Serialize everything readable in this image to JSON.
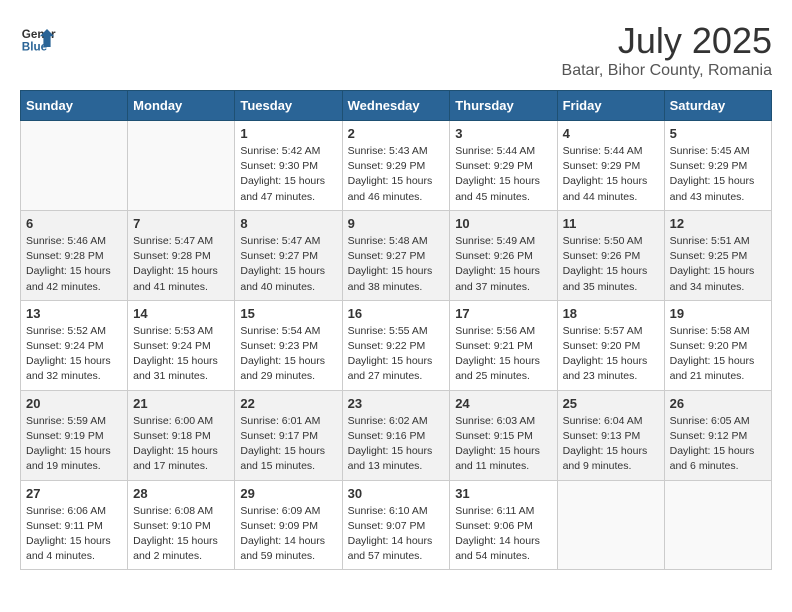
{
  "header": {
    "logo_line1": "General",
    "logo_line2": "Blue",
    "month_year": "July 2025",
    "location": "Batar, Bihor County, Romania"
  },
  "weekdays": [
    "Sunday",
    "Monday",
    "Tuesday",
    "Wednesday",
    "Thursday",
    "Friday",
    "Saturday"
  ],
  "weeks": [
    [
      {
        "day": "",
        "info": ""
      },
      {
        "day": "",
        "info": ""
      },
      {
        "day": "1",
        "sunrise": "5:42 AM",
        "sunset": "9:30 PM",
        "daylight": "15 hours and 47 minutes."
      },
      {
        "day": "2",
        "sunrise": "5:43 AM",
        "sunset": "9:29 PM",
        "daylight": "15 hours and 46 minutes."
      },
      {
        "day": "3",
        "sunrise": "5:44 AM",
        "sunset": "9:29 PM",
        "daylight": "15 hours and 45 minutes."
      },
      {
        "day": "4",
        "sunrise": "5:44 AM",
        "sunset": "9:29 PM",
        "daylight": "15 hours and 44 minutes."
      },
      {
        "day": "5",
        "sunrise": "5:45 AM",
        "sunset": "9:29 PM",
        "daylight": "15 hours and 43 minutes."
      }
    ],
    [
      {
        "day": "6",
        "sunrise": "5:46 AM",
        "sunset": "9:28 PM",
        "daylight": "15 hours and 42 minutes."
      },
      {
        "day": "7",
        "sunrise": "5:47 AM",
        "sunset": "9:28 PM",
        "daylight": "15 hours and 41 minutes."
      },
      {
        "day": "8",
        "sunrise": "5:47 AM",
        "sunset": "9:27 PM",
        "daylight": "15 hours and 40 minutes."
      },
      {
        "day": "9",
        "sunrise": "5:48 AM",
        "sunset": "9:27 PM",
        "daylight": "15 hours and 38 minutes."
      },
      {
        "day": "10",
        "sunrise": "5:49 AM",
        "sunset": "9:26 PM",
        "daylight": "15 hours and 37 minutes."
      },
      {
        "day": "11",
        "sunrise": "5:50 AM",
        "sunset": "9:26 PM",
        "daylight": "15 hours and 35 minutes."
      },
      {
        "day": "12",
        "sunrise": "5:51 AM",
        "sunset": "9:25 PM",
        "daylight": "15 hours and 34 minutes."
      }
    ],
    [
      {
        "day": "13",
        "sunrise": "5:52 AM",
        "sunset": "9:24 PM",
        "daylight": "15 hours and 32 minutes."
      },
      {
        "day": "14",
        "sunrise": "5:53 AM",
        "sunset": "9:24 PM",
        "daylight": "15 hours and 31 minutes."
      },
      {
        "day": "15",
        "sunrise": "5:54 AM",
        "sunset": "9:23 PM",
        "daylight": "15 hours and 29 minutes."
      },
      {
        "day": "16",
        "sunrise": "5:55 AM",
        "sunset": "9:22 PM",
        "daylight": "15 hours and 27 minutes."
      },
      {
        "day": "17",
        "sunrise": "5:56 AM",
        "sunset": "9:21 PM",
        "daylight": "15 hours and 25 minutes."
      },
      {
        "day": "18",
        "sunrise": "5:57 AM",
        "sunset": "9:20 PM",
        "daylight": "15 hours and 23 minutes."
      },
      {
        "day": "19",
        "sunrise": "5:58 AM",
        "sunset": "9:20 PM",
        "daylight": "15 hours and 21 minutes."
      }
    ],
    [
      {
        "day": "20",
        "sunrise": "5:59 AM",
        "sunset": "9:19 PM",
        "daylight": "15 hours and 19 minutes."
      },
      {
        "day": "21",
        "sunrise": "6:00 AM",
        "sunset": "9:18 PM",
        "daylight": "15 hours and 17 minutes."
      },
      {
        "day": "22",
        "sunrise": "6:01 AM",
        "sunset": "9:17 PM",
        "daylight": "15 hours and 15 minutes."
      },
      {
        "day": "23",
        "sunrise": "6:02 AM",
        "sunset": "9:16 PM",
        "daylight": "15 hours and 13 minutes."
      },
      {
        "day": "24",
        "sunrise": "6:03 AM",
        "sunset": "9:15 PM",
        "daylight": "15 hours and 11 minutes."
      },
      {
        "day": "25",
        "sunrise": "6:04 AM",
        "sunset": "9:13 PM",
        "daylight": "15 hours and 9 minutes."
      },
      {
        "day": "26",
        "sunrise": "6:05 AM",
        "sunset": "9:12 PM",
        "daylight": "15 hours and 6 minutes."
      }
    ],
    [
      {
        "day": "27",
        "sunrise": "6:06 AM",
        "sunset": "9:11 PM",
        "daylight": "15 hours and 4 minutes."
      },
      {
        "day": "28",
        "sunrise": "6:08 AM",
        "sunset": "9:10 PM",
        "daylight": "15 hours and 2 minutes."
      },
      {
        "day": "29",
        "sunrise": "6:09 AM",
        "sunset": "9:09 PM",
        "daylight": "14 hours and 59 minutes."
      },
      {
        "day": "30",
        "sunrise": "6:10 AM",
        "sunset": "9:07 PM",
        "daylight": "14 hours and 57 minutes."
      },
      {
        "day": "31",
        "sunrise": "6:11 AM",
        "sunset": "9:06 PM",
        "daylight": "14 hours and 54 minutes."
      },
      {
        "day": "",
        "info": ""
      },
      {
        "day": "",
        "info": ""
      }
    ]
  ],
  "labels": {
    "sunrise_prefix": "Sunrise: ",
    "sunset_prefix": "Sunset: ",
    "daylight_prefix": "Daylight: "
  }
}
